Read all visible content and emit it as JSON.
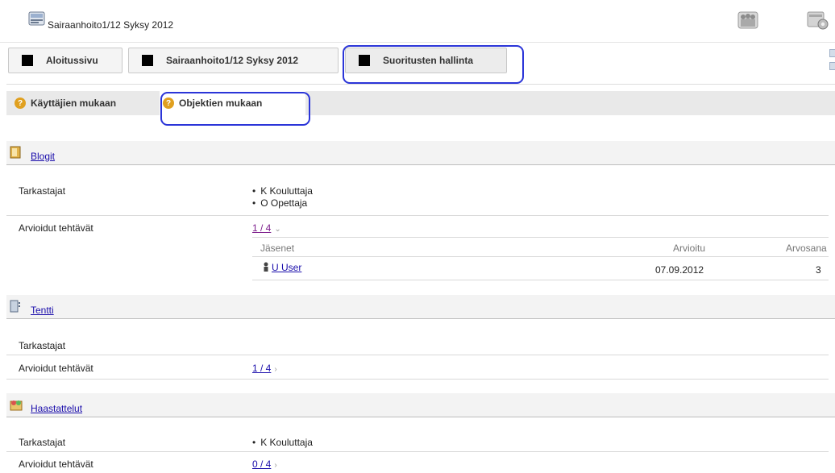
{
  "header": {
    "course_title": "Sairaanhoito1/12 Syksy 2012"
  },
  "main_tabs": [
    {
      "label": "Aloitussivu"
    },
    {
      "label": "Sairaanhoito1/12 Syksy 2012"
    },
    {
      "label": "Suoritusten hallinta"
    }
  ],
  "sub_tabs": [
    {
      "label": "Käyttäjien mukaan"
    },
    {
      "label": "Objektien mukaan"
    }
  ],
  "sections": [
    {
      "title": "Blogit",
      "reviewers_label": "Tarkastajat",
      "reviewers": [
        "K Kouluttaja",
        "O Opettaja"
      ],
      "graded_label": "Arvioidut tehtävät",
      "graded": "1 / 4",
      "table": {
        "headers": [
          "Jäsenet",
          "Arvioitu",
          "Arvosana"
        ],
        "rows": [
          {
            "member": "U User",
            "date": "07.09.2012",
            "grade": "3"
          }
        ]
      }
    },
    {
      "title": "Tentti",
      "reviewers_label": "Tarkastajat",
      "graded_label": "Arvioidut tehtävät",
      "graded": "1 / 4"
    },
    {
      "title": "Haastattelut",
      "reviewers_label": "Tarkastajat",
      "reviewers": [
        "K Kouluttaja"
      ],
      "graded_label": "Arvioidut tehtävät",
      "graded": "0 / 4"
    }
  ],
  "colors": {
    "accent_ring": "#2b35d8",
    "link": "#1a0dab",
    "visited_link": "#7d1e8c"
  }
}
